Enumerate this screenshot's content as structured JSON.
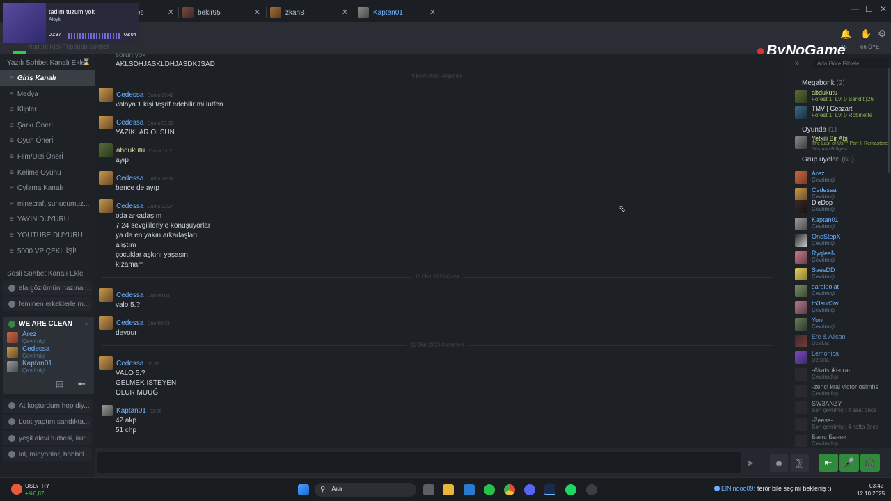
{
  "tabs": [
    {
      "label": "es",
      "close": "✕"
    },
    {
      "label": "bekir95",
      "close": "✕"
    },
    {
      "label": "zkanB",
      "close": "✕"
    },
    {
      "label": "Kaptan01",
      "close": "✕"
    }
  ],
  "window_controls": {
    "minimize": "—",
    "maximize": "☐",
    "close": "✕"
  },
  "media": {
    "title": "tadım tuzum yok",
    "artist": "Aloyli",
    "elapsed": "00:37",
    "duration": "03:04"
  },
  "header": {
    "watermark": "ByNoGame",
    "kick_badge": "K",
    "kick_count": "7",
    "members_count": "66 ÜYE",
    "online_count": "15",
    "faded_title": "Nadüm Kick Tepbüdü Sohbet"
  },
  "sidebar": {
    "add_text_channel": "Yazılı Sohbet Kanalı Ekle",
    "text_channels": [
      "Giriş Kanalı",
      "Medya",
      "Klipler",
      "Şarkı Önerİ",
      "Oyun Önerİ",
      "Film/Dizi Önerİ",
      "Kelime Oyunu",
      "Oylama Kanalı",
      "minecraft sunucumuz...",
      "YAYIN DUYURU",
      "YOUTUBE DUYURU",
      "5000 VP ÇEKİLİŞİ!"
    ],
    "add_voice_channel": "Sesli Sohbet Kanalı Ekle",
    "voice_channels_top": [
      "ela gözlümün nazına ...",
      "feminen erkeklerle m..."
    ],
    "active_voice": {
      "name": "WE ARE CLEAN",
      "members": [
        {
          "name": "Arez",
          "status": "Çevrimiçi"
        },
        {
          "name": "Cedessa",
          "status": "Çevrimiçi"
        },
        {
          "name": "Kaptan01",
          "status": "Çevrimiçi"
        }
      ]
    },
    "voice_channels_bottom": [
      "At koşturdum hop diy...",
      "Loot yaptım sandıkta,...",
      "yeşil alevi türbesi, kur...",
      "lol, minyonlar, hobbitl..."
    ]
  },
  "chat": {
    "top_fragment": "sorun yok",
    "top_line": "AKLSDHJASKLDHJASDKJSAD",
    "date_1": "9 Ekim 2025 Perşembe",
    "date_2": "10 Ekim 2025 Cuma",
    "date_3": "11 Ekim 2025 Cumartesi",
    "messages": [
      {
        "author": "Cedessa",
        "time": "Cuma 00:42",
        "lines": [
          "valoya 1 kişi teşrif edebilir mi lütfen"
        ]
      },
      {
        "author": "Cedessa",
        "time": "Cuma 01:32",
        "lines": [
          "YAZIKLAR OLSUN"
        ]
      },
      {
        "author": "abdukutu",
        "time": "Cuma 11:11",
        "lines": [
          "ayıp"
        ]
      },
      {
        "author": "Cedessa",
        "time": "Cuma 20:16",
        "lines": [
          "bence de ayıp"
        ]
      },
      {
        "author": "Cedessa",
        "time": "Cuma 22:24",
        "lines": [
          "oda arkadaşım",
          "7 24 sevgilileriyle konuşuyorlar",
          "ya da en yakın arkadaşları",
          "alıştım",
          "çocuklar aşkını yaşasın",
          "kızamam"
        ]
      },
      {
        "author": "Cedessa",
        "time": "Dün 00:02",
        "lines": [
          "valo 5.?"
        ]
      },
      {
        "author": "Cedessa",
        "time": "Dün 00:33",
        "lines": [
          "devour"
        ]
      },
      {
        "author": "Cedessa",
        "time": "00:05",
        "lines": [
          "VALO 5.?",
          "GELMEK İSTEYEN",
          "OLUR MUUĞ"
        ]
      },
      {
        "author": "Kaptan01",
        "time": "03:26",
        "lines": [
          "42 akp",
          "51 chp"
        ]
      }
    ]
  },
  "members": {
    "filter_placeholder": "Ada Göre Filtrele",
    "groups": [
      {
        "name": "Megabonk",
        "count": "(2)"
      },
      {
        "name": "Oyunda",
        "count": "(1)"
      },
      {
        "name": "Grup üyeleri",
        "count": "(63)"
      }
    ],
    "megabonk": [
      {
        "name": "abdukutu",
        "status": "Forest 1: Lvl 0 Bandit [26"
      },
      {
        "name": "TMV | Geazart",
        "status": "Forest 1: Lvl 0 Robinette"
      }
    ],
    "ingame": [
      {
        "name": "Yetkili Bir Abi",
        "status": "The Last of Us™ Part II Remastered",
        "status2": "Düşman Bölgesi"
      }
    ],
    "group": [
      {
        "name": "Arez",
        "status": "Çevrimiçi",
        "off": false
      },
      {
        "name": "Cedessa",
        "status": "Çevrimiçi",
        "off": false
      },
      {
        "name": "DieDop",
        "status": "Çevrimiçi",
        "off": false
      },
      {
        "name": "Kaptan01",
        "status": "Çevrimiçi",
        "off": false
      },
      {
        "name": "OneStepX",
        "status": "Çevrimiçi",
        "off": false
      },
      {
        "name": "RyqleaN",
        "status": "Çevrimiçi",
        "off": false
      },
      {
        "name": "SaesDD",
        "status": "Çevrimiçi",
        "off": false
      },
      {
        "name": "sarbipolat",
        "status": "Çevrimiçi",
        "off": false
      },
      {
        "name": "th3sud3w",
        "status": "Çevrimiçi",
        "off": false
      },
      {
        "name": "Yoni",
        "status": "Çevrimiçi",
        "off": false
      },
      {
        "name": "Efe & Alican",
        "status": "Uzakta",
        "off": false
      },
      {
        "name": "Lemonica",
        "status": "Uzakta",
        "off": false
      },
      {
        "name": "-Akatsuki-cra-",
        "status": "Çevrimdışı",
        "off": true
      },
      {
        "name": "-zenci kral victor osimhe",
        "status": "Çevrimdışı",
        "off": true
      },
      {
        "name": "SW3ANZY",
        "status": "Son çevrimiçi: 4 saat önce",
        "off": true
      },
      {
        "name": "-Zeess-",
        "status": "Son çevrimiçi: 4 hafta önce",
        "off": true
      },
      {
        "name": "Баггс Банни",
        "status": "Çevrimdışı",
        "off": true
      }
    ]
  },
  "taskbar": {
    "ticker_name": "USD/TRY",
    "ticker_change": "+%0,87",
    "search_placeholder": "Ara",
    "notification_user": "ElNinooo09:",
    "notification_text": "terör bile seçimi bekleniş :)",
    "time": "03:42",
    "date": "12.10.2025"
  },
  "colors": {
    "accent_blue": "#6fb3ff",
    "voice_green": "#2f8a3c",
    "ingame_green": "#8ab14a"
  }
}
